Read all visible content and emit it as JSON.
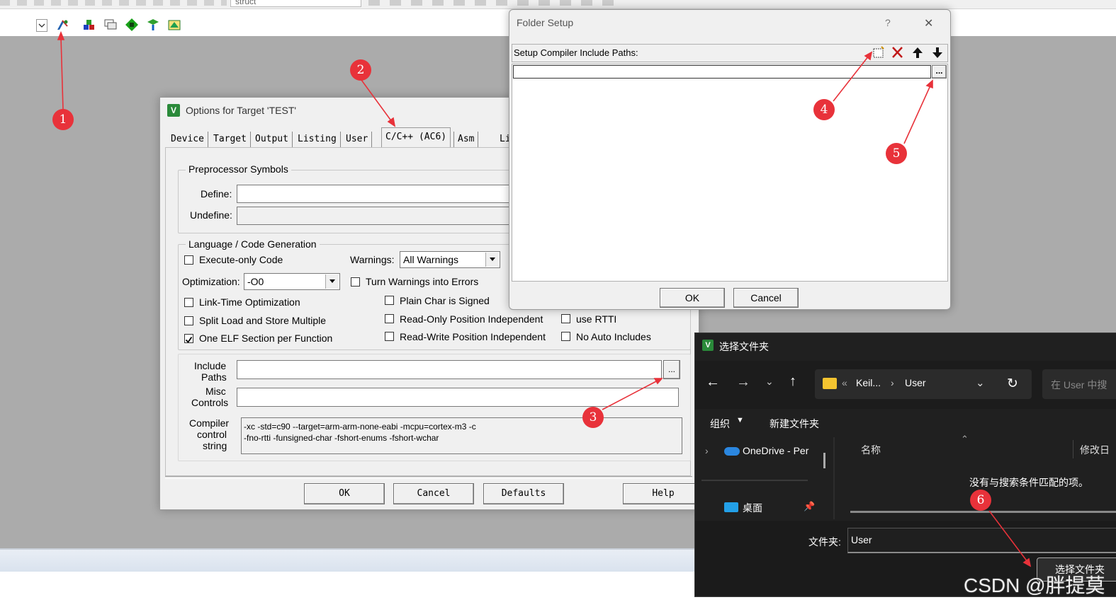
{
  "top_toolbar": {
    "search_value": "struct"
  },
  "options_dialog": {
    "title": "Options for Target 'TEST'",
    "tabs": [
      "Device",
      "Target",
      "Output",
      "Listing",
      "User",
      "C/C++ (AC6)",
      "Asm",
      "Li"
    ],
    "active_tab": "C/C++ (AC6)",
    "preprocessor": {
      "legend": "Preprocessor Symbols",
      "define_label": "Define:",
      "undefine_label": "Undefine:",
      "define_value": "",
      "undefine_value": ""
    },
    "language": {
      "legend": "Language / Code Generation",
      "execute_only": "Execute-only Code",
      "warnings_label": "Warnings:",
      "warnings_value": "All Warnings",
      "optimization_label": "Optimization:",
      "optimization_value": "-O0",
      "turn_warnings": "Turn Warnings into Errors",
      "lto": "Link-Time Optimization",
      "plain_char": "Plain Char is Signed",
      "split_load": "Split Load and Store Multiple",
      "ropi": "Read-Only Position Independent",
      "use_rtti": "use RTTI",
      "one_elf": "One ELF Section per Function",
      "rwpi": "Read-Write Position Independent",
      "no_auto": "No Auto Includes"
    },
    "include_label_1": "Include",
    "include_label_2": "Paths",
    "misc_label_1": "Misc",
    "misc_label_2": "Controls",
    "compiler_label_1": "Compiler",
    "compiler_label_2": "control",
    "compiler_label_3": "string",
    "compiler_line_1": "-xc -std=c90 --target=arm-arm-none-eabi -mcpu=cortex-m3 -c",
    "compiler_line_2": "-fno-rtti -funsigned-char -fshort-enums -fshort-wchar",
    "browse": "...",
    "buttons": {
      "ok": "OK",
      "cancel": "Cancel",
      "defaults": "Defaults",
      "help": "Help"
    }
  },
  "folder_setup": {
    "title": "Folder Setup",
    "help": "?",
    "close": "✕",
    "header": "Setup Compiler Include Paths:",
    "browse": "...",
    "ok": "OK",
    "cancel": "Cancel"
  },
  "select_folder": {
    "title": "选择文件夹",
    "breadcrumb_1": "Keil...",
    "breadcrumb_sep": "›",
    "breadcrumb_prefix": "«",
    "breadcrumb_2": "User",
    "search_placeholder": "在 User 中搜",
    "organize": "组织",
    "new_folder": "新建文件夹",
    "onedrive": "OneDrive - Per",
    "desktop": "桌面",
    "col_name": "名称",
    "col_modified": "修改日",
    "empty_msg": "没有与搜索条件匹配的项。",
    "folder_label": "文件夹:",
    "folder_value": "User",
    "select_button": "选择文件夹"
  },
  "annotations": [
    "1",
    "2",
    "3",
    "4",
    "5",
    "6"
  ],
  "watermark": "CSDN @胖提莫"
}
